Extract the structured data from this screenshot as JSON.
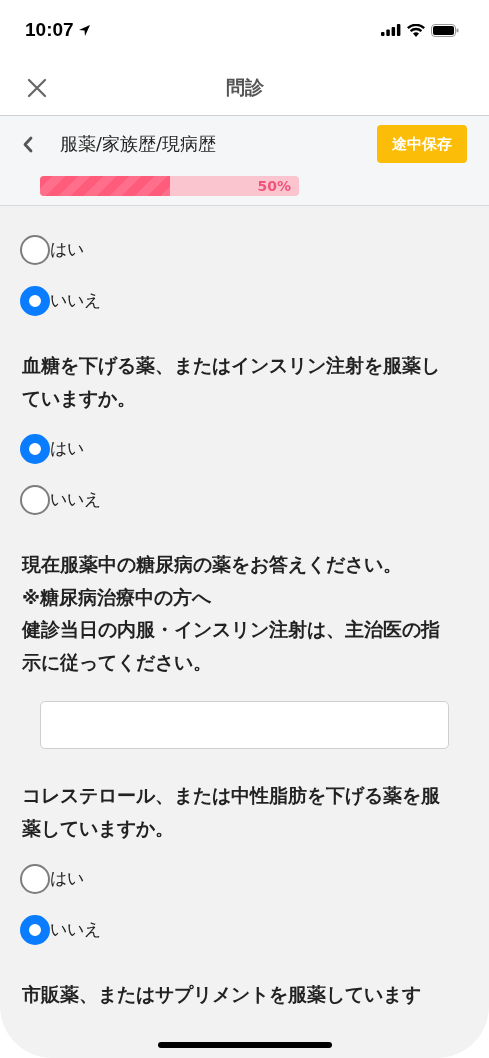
{
  "status_bar": {
    "time": "10:07"
  },
  "nav": {
    "title": "問診"
  },
  "section": {
    "title": "服薬/家族歴/現病歴",
    "save_button": "途中保存",
    "progress": {
      "level": 0.5,
      "label": "50%"
    }
  },
  "items": [
    {
      "kind": "radio",
      "label": "はい",
      "selected": false
    },
    {
      "kind": "radio",
      "label": "いいえ",
      "selected": true
    },
    {
      "kind": "question",
      "lines": [
        "血糖を下げる薬、またはインスリン注射を服薬していますか。"
      ]
    },
    {
      "kind": "radio",
      "label": "はい",
      "selected": true
    },
    {
      "kind": "radio",
      "label": "いいえ",
      "selected": false
    },
    {
      "kind": "question",
      "lines": [
        "現在服薬中の糖尿病の薬をお答えください。",
        "※糖尿病治療中の方へ",
        "健診当日の内服・インスリン注射は、主治医の指示に従ってください。"
      ]
    },
    {
      "kind": "input"
    },
    {
      "kind": "question",
      "lines": [
        "コレステロール、または中性脂肪を下げる薬を服薬していますか。"
      ]
    },
    {
      "kind": "radio",
      "label": "はい",
      "selected": false
    },
    {
      "kind": "radio",
      "label": "いいえ",
      "selected": true
    },
    {
      "kind": "question",
      "lines": [
        "市販薬、またはサプリメントを服薬しています"
      ]
    }
  ]
}
